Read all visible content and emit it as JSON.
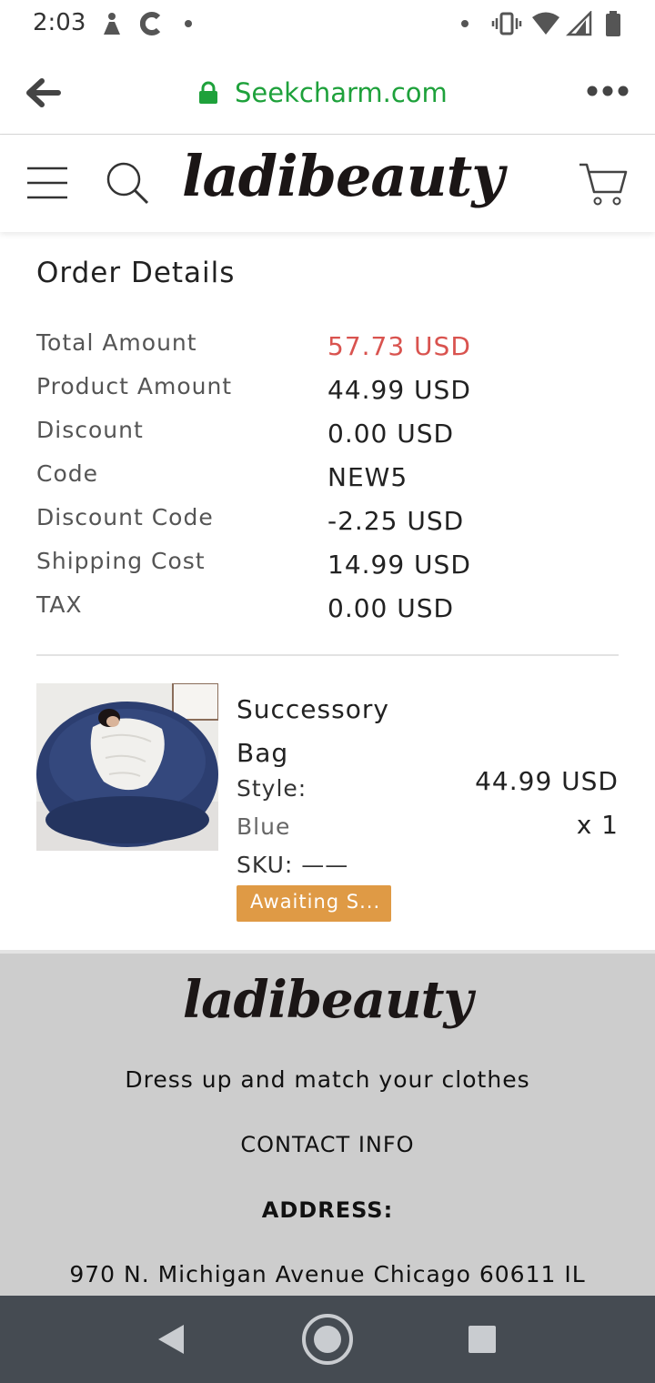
{
  "status_bar": {
    "time": "2:03"
  },
  "browser": {
    "url": "Seekcharm.com"
  },
  "header": {
    "logo": "ladibeauty"
  },
  "order": {
    "title": "Order Details",
    "rows": [
      {
        "label": "Total Amount",
        "value": "57.73 USD"
      },
      {
        "label": "Product Amount",
        "value": "44.99 USD"
      },
      {
        "label": "Discount",
        "value": "0.00 USD"
      },
      {
        "label": "Code",
        "value": "NEW5"
      },
      {
        "label": "Discount Code",
        "value": "-2.25 USD"
      },
      {
        "label": "Shipping Cost",
        "value": "14.99 USD"
      },
      {
        "label": "TAX",
        "value": "0.00 USD"
      }
    ]
  },
  "product": {
    "name": "Successory Bag",
    "style_label": "Style:",
    "style_value": "Blue",
    "sku": "SKU: ——",
    "price": "44.99 USD",
    "qty": "x 1",
    "status": "Awaiting S..."
  },
  "footer": {
    "logo": "ladibeauty",
    "tagline": "Dress up and match your clothes",
    "contact": "CONTACT INFO",
    "address_heading": "ADDRESS:",
    "address": "970 N. Michigan Avenue Chicago 60611 IL"
  },
  "colors": {
    "url_green": "#1ea13b",
    "total_red": "#d9534f",
    "badge_orange": "#df9a45",
    "footer_bg": "#cdcdcd",
    "navbar_bg": "#454b52"
  }
}
